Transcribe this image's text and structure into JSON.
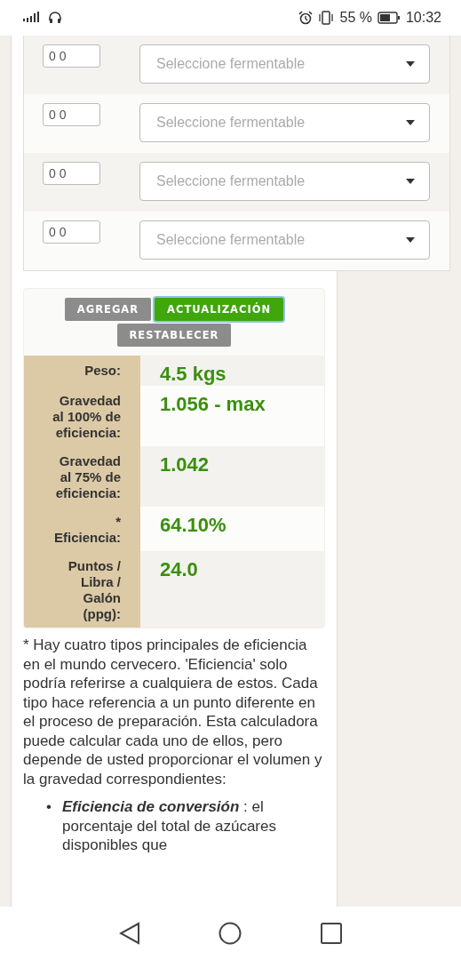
{
  "status_bar": {
    "battery": "55 %",
    "time": "10:32"
  },
  "fermentables": [
    {
      "amount": "0 0",
      "placeholder": "Seleccione fermentable"
    },
    {
      "amount": "0 0",
      "placeholder": "Seleccione fermentable"
    },
    {
      "amount": "0 0",
      "placeholder": "Seleccione fermentable"
    },
    {
      "amount": "0 0",
      "placeholder": "Seleccione fermentable"
    }
  ],
  "buttons": [
    {
      "label": "AGREGAR",
      "highlighted": false
    },
    {
      "label": "ACTUALIZACIÓN",
      "highlighted": true
    },
    {
      "label": "RESTABLECER",
      "highlighted": false
    }
  ],
  "results": [
    {
      "label": "Peso:",
      "value": "4.5 kgs"
    },
    {
      "label": "Gravedad al 100% de eficiencia:",
      "value": "1.056 - max"
    },
    {
      "label": "Gravedad al 75% de eficiencia:",
      "value": "1.042"
    },
    {
      "label": "* Eficiencia:",
      "value": "64.10%"
    },
    {
      "label": "Puntos / Libra / Galón (ppg):",
      "value": "24.0"
    }
  ],
  "note": "* Hay cuatro tipos principales de eficiencia en el mundo cervecero. 'Eficiencia' solo podría referirse a cualquiera de estos. Cada tipo hace referencia a un punto diferente en el proceso de preparación. Esta calculadora puede calcular cada uno de ellos, pero depende de usted proporcionar el volumen y la gravedad correspondientes:",
  "bullets": [
    {
      "marker": "•",
      "text": "**Eficiencia de conversión** : el porcentaje del total de azúcares disponibles que"
    }
  ]
}
